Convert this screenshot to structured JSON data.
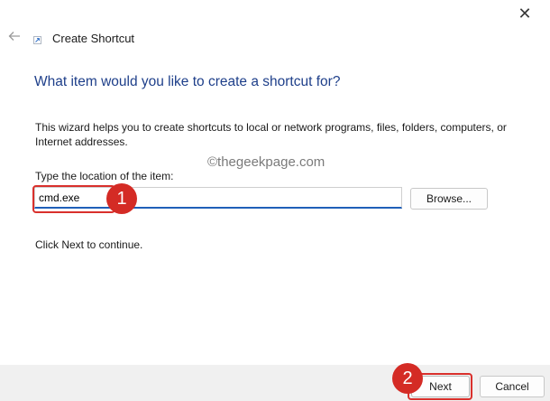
{
  "window": {
    "title": "Create Shortcut",
    "close_glyph": "✕"
  },
  "wizard": {
    "heading": "What item would you like to create a shortcut for?",
    "description": "This wizard helps you to create shortcuts to local or network programs, files, folders, computers, or Internet addresses.",
    "location_label": "Type the location of the item:",
    "location_value": "cmd.exe",
    "browse_label": "Browse...",
    "continue_text": "Click Next to continue."
  },
  "watermark": "©thegeekpage.com",
  "annotations": {
    "step1": "1",
    "step2": "2",
    "color": "#d42b25"
  },
  "footer": {
    "next_label": "Next",
    "cancel_label": "Cancel"
  },
  "colors": {
    "heading": "#1e3f8a",
    "input_underline": "#1f5fb8"
  },
  "icons": {
    "back": "back-arrow-icon",
    "title": "shortcut-icon",
    "close": "close-icon"
  }
}
